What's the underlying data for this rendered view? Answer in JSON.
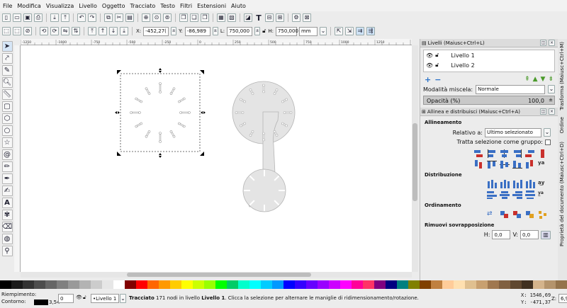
{
  "menu": [
    "File",
    "Modifica",
    "Visualizza",
    "Livello",
    "Oggetto",
    "Tracciato",
    "Testo",
    "Filtri",
    "Estensioni",
    "Aiuto"
  ],
  "toolbar2": {
    "x_label": "X:",
    "x_value": "-452,27(",
    "y_label": "Y:",
    "y_value": "-86,989",
    "w_label": "L:",
    "w_value": "750,000",
    "h_label": "H:",
    "h_value": "750,000",
    "unit": "mm"
  },
  "ruler_top": [
    "-1250",
    "-1000",
    "-750",
    "-500",
    "-250",
    "0",
    "250",
    "500",
    "750",
    "1000",
    "1250",
    "1500",
    "1750"
  ],
  "layers_panel": {
    "title": "Livelli (Maiusc+Ctrl+L)",
    "layers": [
      "Livello 1",
      "Livello 2"
    ],
    "blend_label": "Modalità miscela:",
    "blend_value": "Normale",
    "opacity_label": "Opacità (%)",
    "opacity_value": "100,0",
    "opacity": 1.0
  },
  "align_panel": {
    "title": "Allinea e distribuisci (Maiusc+Ctrl+A)",
    "alignment": "Allineamento",
    "relative_label": "Relativo a:",
    "relative_value": "Ultimo selezionato",
    "treat_group": "Tratta selezione come gruppo:",
    "distribution": "Distribuzione",
    "ordering": "Ordinamento",
    "remove_overlap": "Rimuovi sovrapposizione",
    "h_label": "H:",
    "h_value": "0,0",
    "v_label": "V:",
    "v_value": "0,0"
  },
  "side_tabs": [
    "Trasforma (Maiusc+Ctrl+M)",
    "Ordine",
    "Proprietà del documento (Maiusc+Ctrl+D)"
  ],
  "status": {
    "fill_label": "Riempimento:",
    "stroke_label": "Contorno:",
    "stroke_width": "3,54",
    "opacity_value": "0",
    "layer_value": "•Livello 1",
    "message_bold": "Tracciato",
    "message": " 171 nodi in livello ",
    "message_layer": "Livello 1",
    "message_tail": ". Clicca la selezione per alternare le maniglie di ridimensionamento/rotazione.",
    "x_coord": "X: 1546,69",
    "y_coord": "Y: -471,37",
    "zoom_label": "Z:",
    "zoom_value": "6,9"
  },
  "palette": [
    "#000000",
    "#1a1a1a",
    "#333333",
    "#4d4d4d",
    "#666666",
    "#808080",
    "#999999",
    "#b3b3b3",
    "#cccccc",
    "#e6e6e6",
    "#ffffff",
    "#800000",
    "#ff0000",
    "#ff6600",
    "#ff9900",
    "#ffcc00",
    "#ffff00",
    "#ccff00",
    "#99ff00",
    "#00ff00",
    "#00cc66",
    "#00ffcc",
    "#00ffff",
    "#00ccff",
    "#0099ff",
    "#0000ff",
    "#3300ff",
    "#6600ff",
    "#9900ff",
    "#cc00ff",
    "#ff00ff",
    "#ff0099",
    "#ff3366",
    "#800080",
    "#000080",
    "#008080",
    "#808000",
    "#804000",
    "#c08040",
    "#ffcc99",
    "#ffe0b0",
    "#e0c090",
    "#c8a070",
    "#a07850",
    "#806040",
    "#604830",
    "#403020",
    "#d4b48c",
    "#b4946c",
    "#94744c"
  ]
}
